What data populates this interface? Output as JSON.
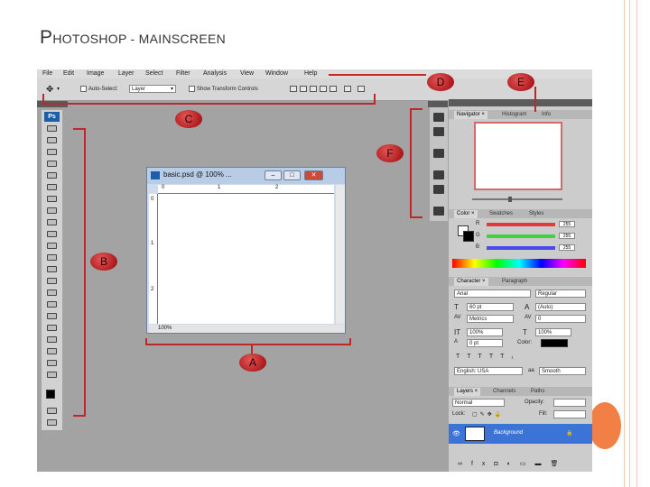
{
  "slide": {
    "title_first": "P",
    "title_rest": "HOTOSHOP - MAINSCREEN",
    "accent_color": "#f27f46",
    "border_color": "#f2c7b6"
  },
  "menubar": {
    "items": [
      "File",
      "Edit",
      "Image",
      "Layer",
      "Select",
      "Filter",
      "Analysis",
      "View",
      "Window",
      "Help"
    ]
  },
  "options_bar": {
    "auto_select_label": "Auto-Select:",
    "auto_select_value": "Layer",
    "transform_label": "Show Transform Controls"
  },
  "toolbox": {
    "logo": "Ps"
  },
  "document": {
    "title": "basic.psd @ 100% ...",
    "zoom": "100%",
    "ruler_top": [
      "0",
      "1",
      "2"
    ],
    "ruler_left": [
      "0",
      "1",
      "2"
    ]
  },
  "navigator": {
    "tabs": [
      "Navigator ×",
      "Histogram",
      "Info"
    ]
  },
  "color_panel": {
    "tabs": [
      "Color ×",
      "Swatches",
      "Styles"
    ],
    "channels": [
      {
        "label": "R",
        "value": "255",
        "color": "#e33b3b"
      },
      {
        "label": "G",
        "value": "255",
        "color": "#3fd43f"
      },
      {
        "label": "B",
        "value": "255",
        "color": "#4a4ae8"
      }
    ]
  },
  "character_panel": {
    "tabs": [
      "Character ×",
      "Paragraph"
    ],
    "font_family": "Arial",
    "font_style": "Regular",
    "size": "60 pt",
    "leading": "(Auto)",
    "kerning": "Metrics",
    "tracking": "0",
    "vscale": "100%",
    "hscale": "100%",
    "baseline": "0 pt",
    "color_label": "Color:",
    "language": "English: USA",
    "aa": "Smooth"
  },
  "layers_panel": {
    "tabs": [
      "Layers ×",
      "Channels",
      "Paths"
    ],
    "blend_mode": "Normal",
    "opacity_label": "Opacity:",
    "lock_label": "Lock:",
    "fill_label": "Fill:",
    "layer_name": "Background"
  },
  "callouts": [
    "A",
    "B",
    "C",
    "D",
    "E",
    "F"
  ],
  "callout_color": "#c0272d"
}
